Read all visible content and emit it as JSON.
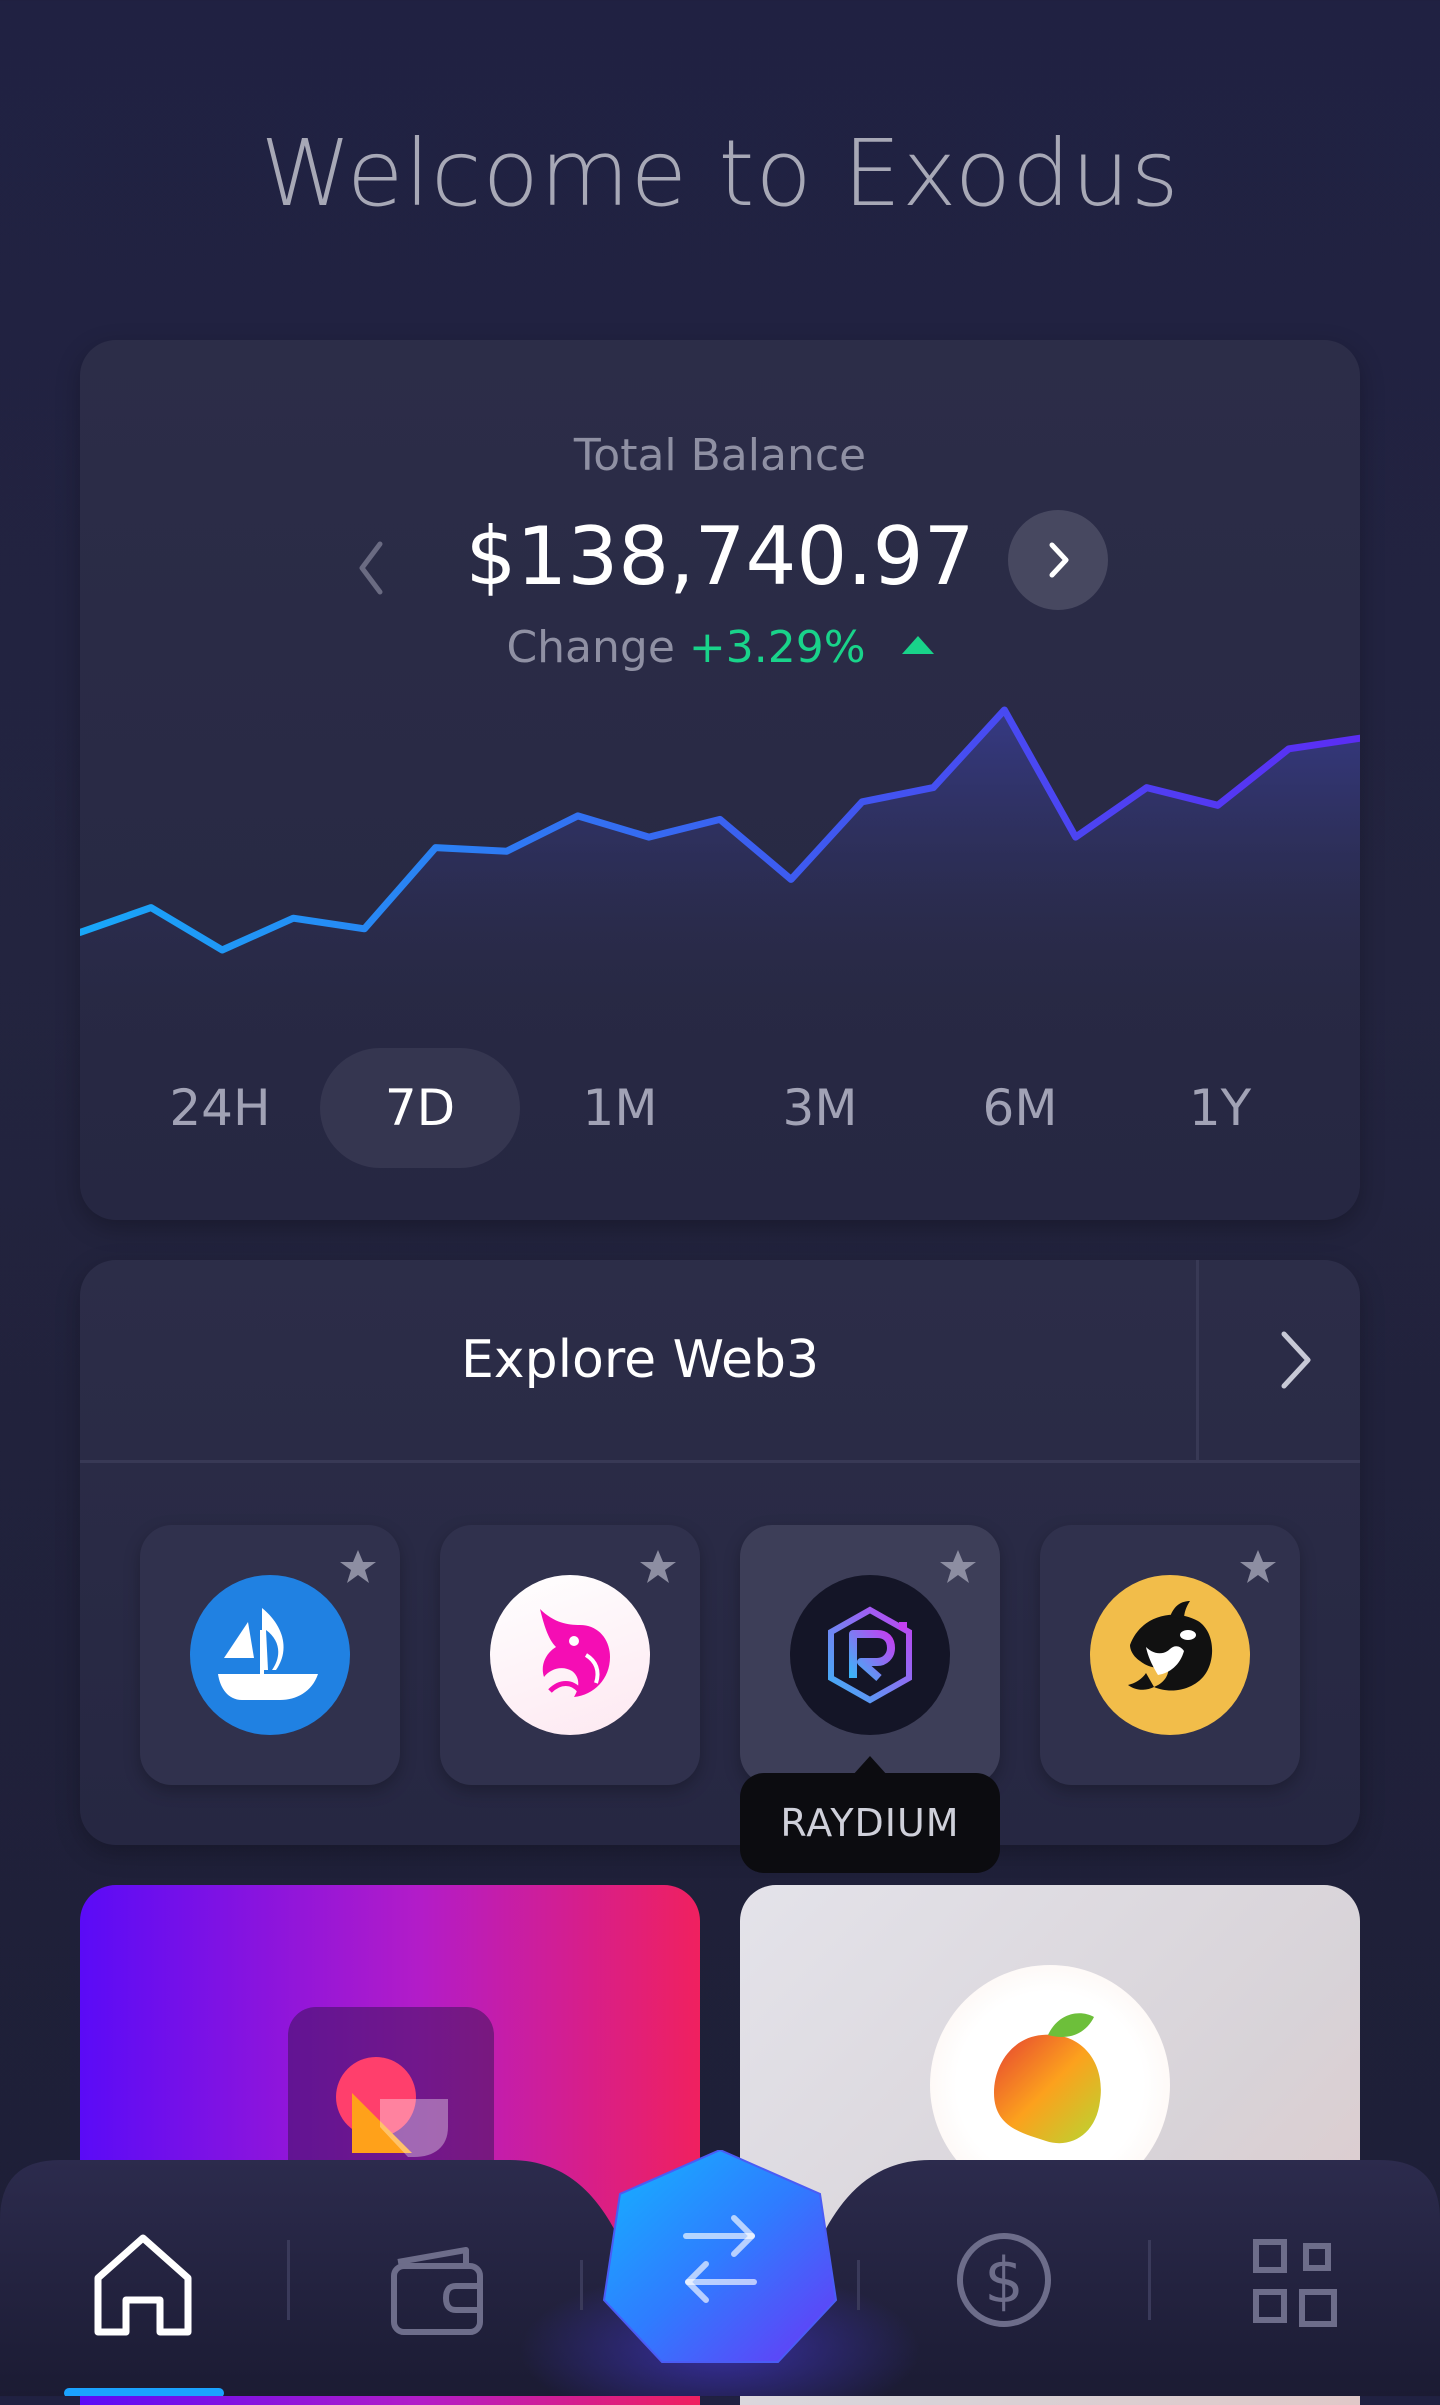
{
  "header": {
    "title": "Welcome to Exodus"
  },
  "balance": {
    "label": "Total Balance",
    "amount": "$138,740.97",
    "change_label": "Change",
    "change_value": "+3.29%",
    "change_direction": "up"
  },
  "ranges": [
    {
      "label": "24H",
      "active": false
    },
    {
      "label": "7D",
      "active": true
    },
    {
      "label": "1M",
      "active": false
    },
    {
      "label": "3M",
      "active": false
    },
    {
      "label": "6M",
      "active": false
    },
    {
      "label": "1Y",
      "active": false
    }
  ],
  "explore": {
    "title": "Explore Web3",
    "apps": [
      {
        "name": "OpenSea",
        "icon": "opensea-icon",
        "favorite": false
      },
      {
        "name": "Uniswap",
        "icon": "uniswap-icon",
        "favorite": false
      },
      {
        "name": "Raydium",
        "icon": "raydium-icon",
        "favorite": false
      },
      {
        "name": "Orca",
        "icon": "orca-icon",
        "favorite": false
      }
    ],
    "tooltip": "RAYDIUM"
  },
  "nav": {
    "items": [
      "home-icon",
      "wallet-icon",
      "swap-icon",
      "dollar-icon",
      "apps-grid-icon"
    ],
    "active": "home-icon"
  },
  "colors": {
    "background": "#202142",
    "card": "#2c2d48",
    "positive": "#19d38a",
    "accent_blue": "#1aa3ff",
    "accent_purple": "#5b3bf5"
  },
  "chart_data": {
    "type": "area",
    "series": [
      {
        "values": [
          10,
          17,
          5,
          14,
          11,
          34,
          33,
          43,
          37,
          42,
          25,
          47,
          51,
          73,
          37,
          51,
          46,
          62,
          65
        ]
      }
    ]
  }
}
